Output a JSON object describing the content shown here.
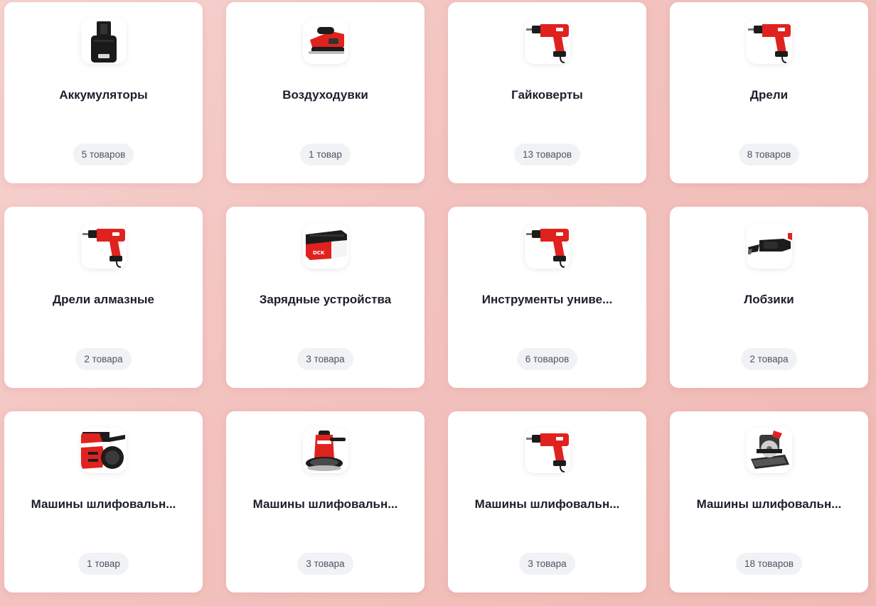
{
  "colors": {
    "card_bg": "#ffffff",
    "title_text": "#1b1f2a",
    "badge_bg": "#f1f2f5",
    "badge_text": "#4d5361",
    "tool_red": "#e0221f",
    "tool_black": "#1c1c1c"
  },
  "categories": [
    {
      "title": "Аккумуляторы",
      "count": "5 товаров",
      "icon": "battery-icon"
    },
    {
      "title": "Воздуходувки",
      "count": "1 товар",
      "icon": "planer-icon"
    },
    {
      "title": "Гайковерты",
      "count": "13 товаров",
      "icon": "drill-icon"
    },
    {
      "title": "Дрели",
      "count": "8 товаров",
      "icon": "drill-icon"
    },
    {
      "title": "Дрели алмазные",
      "count": "2 товара",
      "icon": "drill-icon"
    },
    {
      "title": "Зарядные устройства",
      "count": "3 товара",
      "icon": "battery-pack-icon"
    },
    {
      "title": "Инструменты униве...",
      "count": "6 товаров",
      "icon": "drill-icon"
    },
    {
      "title": "Лобзики",
      "count": "2 товара",
      "icon": "reciprocating-saw-icon"
    },
    {
      "title": "Машины шлифовальн...",
      "count": "1 товар",
      "icon": "angle-grinder-icon"
    },
    {
      "title": "Машины шлифовальн...",
      "count": "3 товара",
      "icon": "wall-sander-icon"
    },
    {
      "title": "Машины шлифовальн...",
      "count": "3 товара",
      "icon": "drill-icon"
    },
    {
      "title": "Машины шлифовальн...",
      "count": "18 товаров",
      "icon": "table-saw-icon"
    }
  ]
}
